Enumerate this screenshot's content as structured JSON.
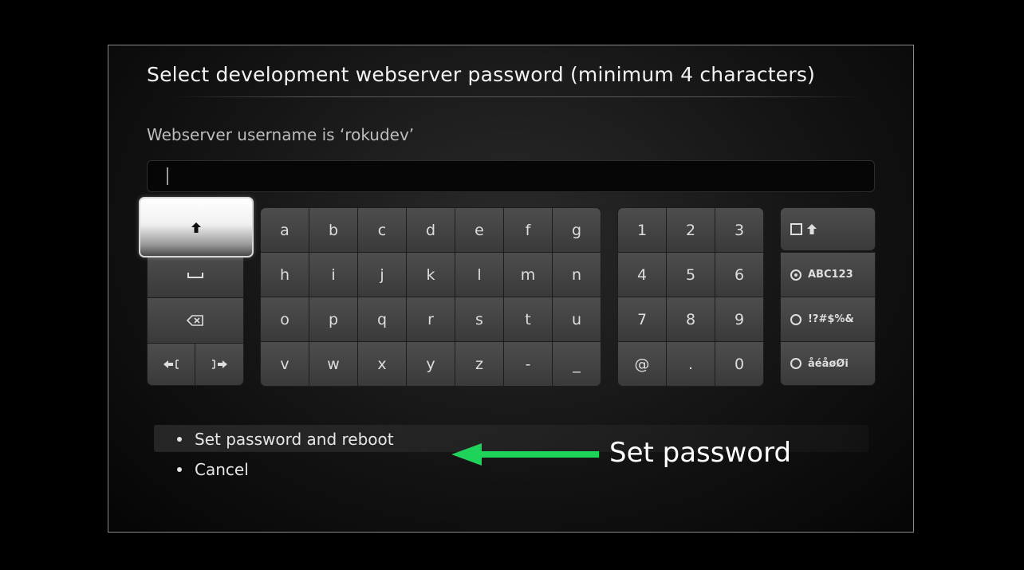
{
  "dialog": {
    "title": "Select development webserver password (minimum 4 characters)",
    "subtitle": "Webserver username is ‘rokudev’",
    "input_value": ""
  },
  "keyboard": {
    "letters": [
      [
        "a",
        "b",
        "c",
        "d",
        "e",
        "f",
        "g"
      ],
      [
        "h",
        "i",
        "j",
        "k",
        "l",
        "m",
        "n"
      ],
      [
        "o",
        "p",
        "q",
        "r",
        "s",
        "t",
        "u"
      ],
      [
        "v",
        "w",
        "x",
        "y",
        "z",
        "-",
        "_"
      ]
    ],
    "numbers": [
      [
        "1",
        "2",
        "3"
      ],
      [
        "4",
        "5",
        "6"
      ],
      [
        "7",
        "8",
        "9"
      ],
      [
        "@",
        ".",
        "0"
      ]
    ],
    "function_keys": {
      "shift": "shift-up-icon",
      "space": "space-icon",
      "backspace": "backspace-icon",
      "cursor_left": "cursor-left-icon",
      "cursor_right": "cursor-right-icon"
    },
    "modes": {
      "caps_lock_icon": "shift-up-icon",
      "abc123": "ABC123",
      "symbols": "!?#$%&",
      "accents": "åéåøØi",
      "selected": "ABC123"
    }
  },
  "options": {
    "set_password": "Set password and reboot",
    "cancel": "Cancel"
  },
  "annotation": {
    "label": "Set password",
    "arrow_color": "#1fd25a"
  }
}
